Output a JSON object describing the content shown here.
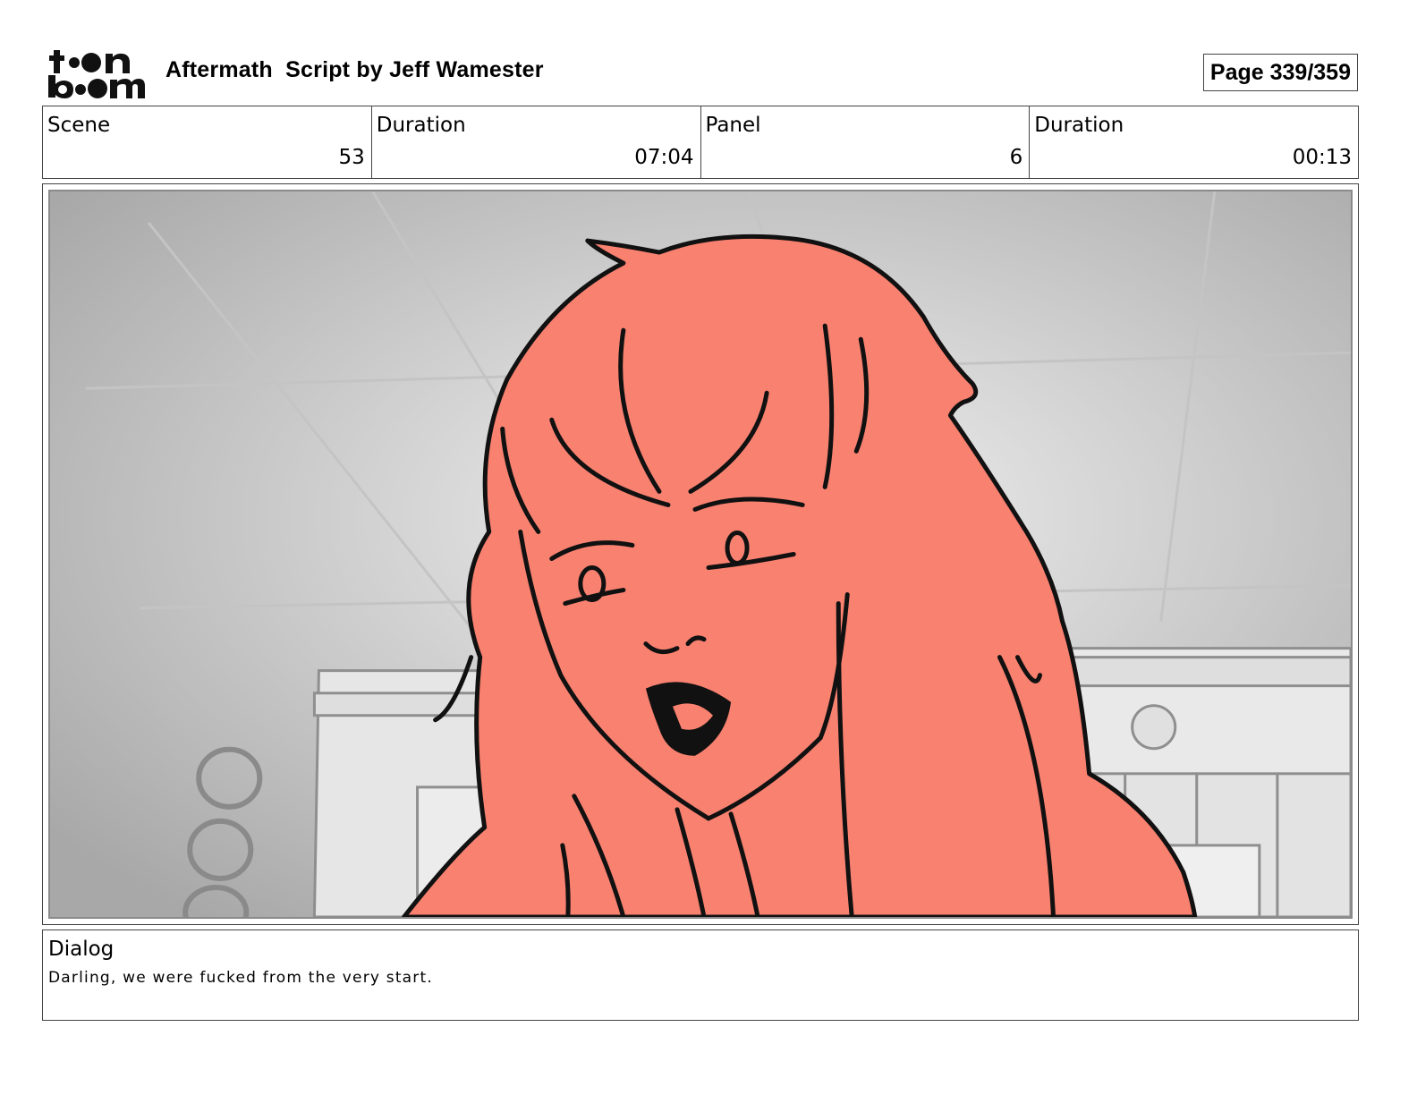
{
  "header": {
    "logo_name": "toonboom-logo",
    "logo_text": "toon boom",
    "title": "Aftermath  Script by Jeff Wamester",
    "page": "Page 339/359"
  },
  "info": {
    "scene_label": "Scene",
    "scene_value": "53",
    "scene_duration_label": "Duration",
    "scene_duration_value": "07:04",
    "panel_label": "Panel",
    "panel_value": "6",
    "panel_duration_label": "Duration",
    "panel_duration_value": "00:13"
  },
  "panel": {
    "image_name": "storyboard-drawing",
    "fill_color": "#f98170",
    "background_color": "#dcdcdc"
  },
  "dialog": {
    "label": "Dialog",
    "text": "Darling, we were fucked from the very start."
  }
}
